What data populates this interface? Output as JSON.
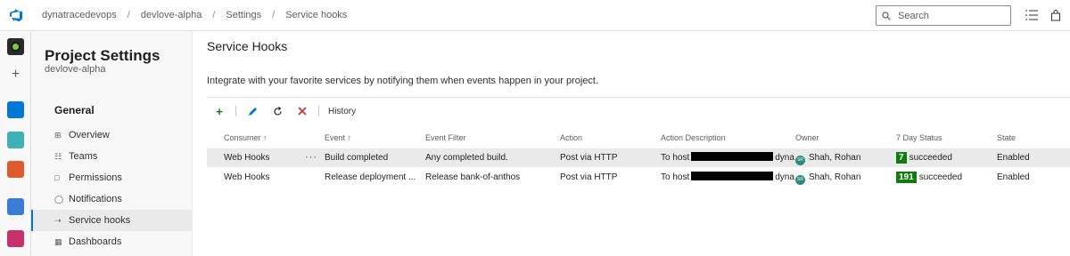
{
  "breadcrumb": [
    "dynatracedevops",
    "devlove-alpha",
    "Settings",
    "Service hooks"
  ],
  "search": {
    "placeholder": "Search"
  },
  "nav": {
    "title": "Project Settings",
    "subtitle": "devlove-alpha",
    "section": "General",
    "items": [
      {
        "label": "Overview",
        "icon": "overview-icon"
      },
      {
        "label": "Teams",
        "icon": "teams-icon"
      },
      {
        "label": "Permissions",
        "icon": "permissions-icon"
      },
      {
        "label": "Notifications",
        "icon": "notifications-icon"
      },
      {
        "label": "Service hooks",
        "icon": "service-hooks-icon",
        "selected": true
      },
      {
        "label": "Dashboards",
        "icon": "dashboards-icon"
      }
    ]
  },
  "main": {
    "title": "Service Hooks",
    "intro": "Integrate with your favorite services by notifying them when events happen in your project.",
    "toolbar": {
      "history_label": "History"
    },
    "columns": [
      "Consumer ↑",
      "Event ↑",
      "Event Filter",
      "Action",
      "Action Description",
      "Owner",
      "7 Day Status",
      "State"
    ],
    "rows": [
      {
        "consumer": "Web Hooks",
        "event": "Build completed",
        "filter": "Any completed build.",
        "action": "Post via HTTP",
        "desc_prefix": "To host",
        "desc_suffix": "dyna...",
        "owner": "Shah, Rohan",
        "owner_initials": "SR",
        "status_count": "7",
        "status_text": "succeeded",
        "state": "Enabled",
        "selected": true
      },
      {
        "consumer": "Web Hooks",
        "event": "Release deployment ...",
        "filter": "Release bank-of-anthos",
        "action": "Post via HTTP",
        "desc_prefix": "To host",
        "desc_suffix": "dyna...",
        "owner": "Shah, Rohan",
        "owner_initials": "SR",
        "status_count": "191",
        "status_text": "succeeded",
        "state": "Enabled",
        "selected": false
      }
    ]
  },
  "colors": {
    "accent": "#0078d4",
    "success": "#107c10",
    "add": "#107c10",
    "delete": "#d13438"
  }
}
